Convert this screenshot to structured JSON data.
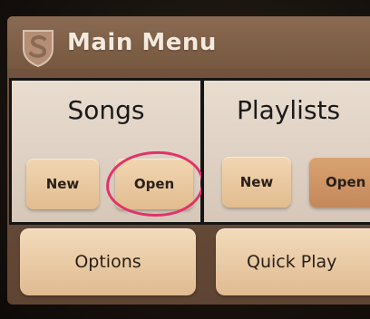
{
  "header": {
    "title": "Main Menu",
    "logo_icon": "shield-s-icon"
  },
  "songs": {
    "title": "Songs",
    "new_label": "New",
    "open_label": "Open"
  },
  "playlists": {
    "title": "Playlists",
    "new_label": "New",
    "open_label": "Open"
  },
  "footer": {
    "options_label": "Options",
    "quick_play_label": "Quick Play"
  },
  "colors": {
    "highlight_ring": "#e0336b",
    "panel_bg": "#e9ddd0",
    "button_bg": "#f1d6b2",
    "screen_bg": "#6d4f3a"
  }
}
